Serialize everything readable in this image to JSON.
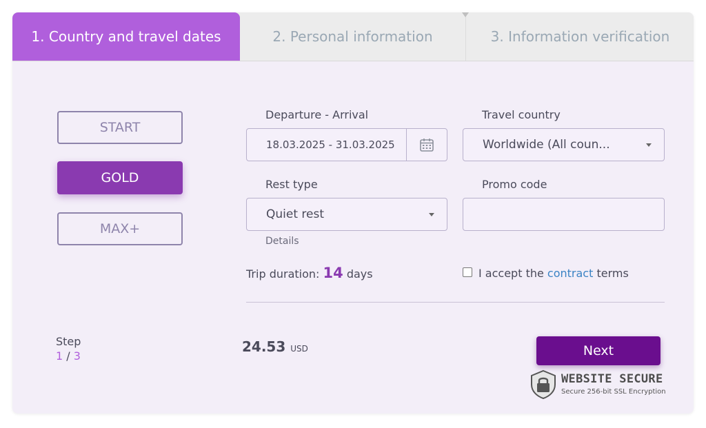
{
  "tabs": [
    {
      "label": "1. Country and travel dates",
      "active": true
    },
    {
      "label": "2. Personal information",
      "active": false
    },
    {
      "label": "3. Information verification",
      "active": false
    }
  ],
  "plans": [
    {
      "label": "START",
      "selected": false
    },
    {
      "label": "GOLD",
      "selected": true
    },
    {
      "label": "MAX+",
      "selected": false
    }
  ],
  "form": {
    "dates": {
      "label": "Departure - Arrival",
      "value": "18.03.2025 - 31.03.2025"
    },
    "country": {
      "label": "Travel country",
      "value": "Worldwide (All coun..."
    },
    "rest": {
      "label": "Rest type",
      "value": "Quiet rest",
      "details": "Details"
    },
    "promo": {
      "label": "Promo code",
      "value": ""
    },
    "duration": {
      "prefix": "Trip duration:",
      "value": "14",
      "suffix": "days"
    },
    "accept": {
      "checked": false,
      "before": "I accept the",
      "link": "contract",
      "after": "terms"
    }
  },
  "step": {
    "label": "Step",
    "current": "1",
    "separator": "/",
    "total": "3"
  },
  "price": {
    "amount": "24.53",
    "currency": "USD"
  },
  "next_label": "Next",
  "secure": {
    "title": "WEBSITE SECURE",
    "subtitle": "Secure 256-bit SSL Encryption"
  },
  "colors": {
    "accent": "#b05fdc",
    "primary": "#6a0e8e",
    "gold": "#8a3ab0",
    "link": "#3b83c4"
  }
}
